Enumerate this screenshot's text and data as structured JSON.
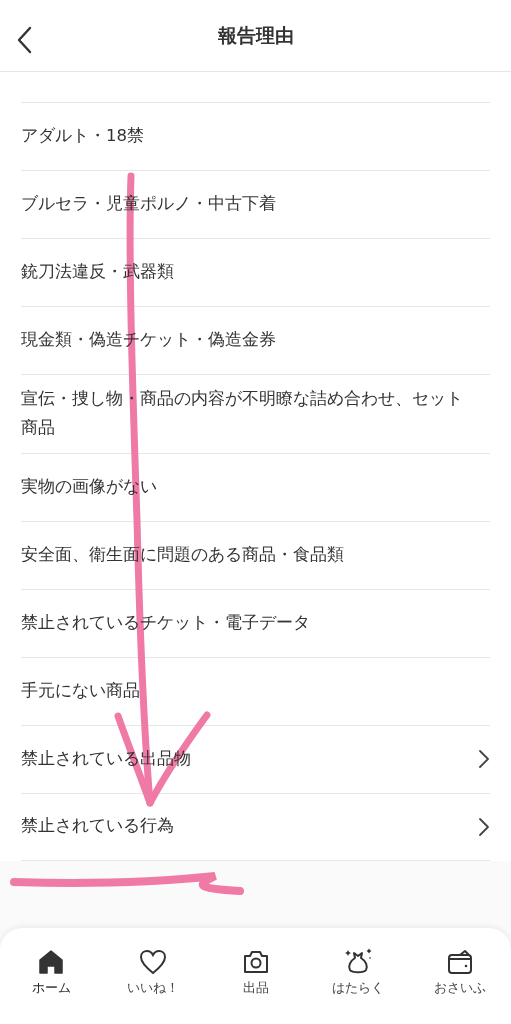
{
  "header": {
    "title": "報告理由"
  },
  "reasons": [
    {
      "label": "アダルト・18禁",
      "has_submenu": false
    },
    {
      "label": "ブルセラ・児童ポルノ・中古下着",
      "has_submenu": false
    },
    {
      "label": "銃刀法違反・武器類",
      "has_submenu": false
    },
    {
      "label": "現金類・偽造チケット・偽造金券",
      "has_submenu": false
    },
    {
      "label": "宣伝・捜し物・商品の内容が不明瞭な詰め合わせ、セット商品",
      "has_submenu": false
    },
    {
      "label": "実物の画像がない",
      "has_submenu": false
    },
    {
      "label": "安全面、衛生面に問題のある商品・食品類",
      "has_submenu": false
    },
    {
      "label": "禁止されているチケット・電子データ",
      "has_submenu": false
    },
    {
      "label": "手元にない商品",
      "has_submenu": false
    },
    {
      "label": "禁止されている出品物",
      "has_submenu": true
    },
    {
      "label": "禁止されている行為",
      "has_submenu": true
    }
  ],
  "annotation": {
    "color": "#ef7aa6"
  },
  "tab_bar": [
    {
      "kind": "home",
      "label": "ホーム",
      "selected": true
    },
    {
      "kind": "heart",
      "label": "いいね！",
      "selected": false
    },
    {
      "kind": "camera",
      "label": "出品",
      "selected": false
    },
    {
      "kind": "bag",
      "label": "はたらく",
      "selected": false
    },
    {
      "kind": "wallet",
      "label": "おさいふ",
      "selected": false
    }
  ]
}
